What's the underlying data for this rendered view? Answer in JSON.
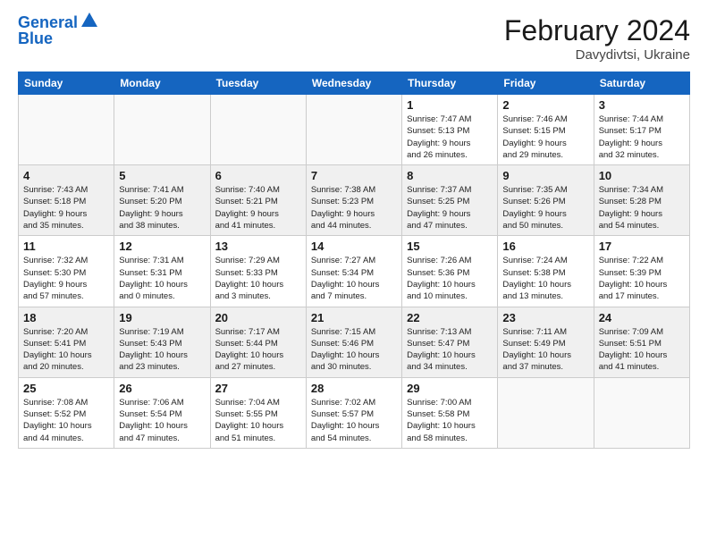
{
  "header": {
    "logo_line1": "General",
    "logo_line2": "Blue",
    "main_title": "February 2024",
    "subtitle": "Davydivtsi, Ukraine"
  },
  "days_of_week": [
    "Sunday",
    "Monday",
    "Tuesday",
    "Wednesday",
    "Thursday",
    "Friday",
    "Saturday"
  ],
  "weeks": [
    [
      {
        "day": "",
        "info": ""
      },
      {
        "day": "",
        "info": ""
      },
      {
        "day": "",
        "info": ""
      },
      {
        "day": "",
        "info": ""
      },
      {
        "day": "1",
        "info": "Sunrise: 7:47 AM\nSunset: 5:13 PM\nDaylight: 9 hours\nand 26 minutes."
      },
      {
        "day": "2",
        "info": "Sunrise: 7:46 AM\nSunset: 5:15 PM\nDaylight: 9 hours\nand 29 minutes."
      },
      {
        "day": "3",
        "info": "Sunrise: 7:44 AM\nSunset: 5:17 PM\nDaylight: 9 hours\nand 32 minutes."
      }
    ],
    [
      {
        "day": "4",
        "info": "Sunrise: 7:43 AM\nSunset: 5:18 PM\nDaylight: 9 hours\nand 35 minutes."
      },
      {
        "day": "5",
        "info": "Sunrise: 7:41 AM\nSunset: 5:20 PM\nDaylight: 9 hours\nand 38 minutes."
      },
      {
        "day": "6",
        "info": "Sunrise: 7:40 AM\nSunset: 5:21 PM\nDaylight: 9 hours\nand 41 minutes."
      },
      {
        "day": "7",
        "info": "Sunrise: 7:38 AM\nSunset: 5:23 PM\nDaylight: 9 hours\nand 44 minutes."
      },
      {
        "day": "8",
        "info": "Sunrise: 7:37 AM\nSunset: 5:25 PM\nDaylight: 9 hours\nand 47 minutes."
      },
      {
        "day": "9",
        "info": "Sunrise: 7:35 AM\nSunset: 5:26 PM\nDaylight: 9 hours\nand 50 minutes."
      },
      {
        "day": "10",
        "info": "Sunrise: 7:34 AM\nSunset: 5:28 PM\nDaylight: 9 hours\nand 54 minutes."
      }
    ],
    [
      {
        "day": "11",
        "info": "Sunrise: 7:32 AM\nSunset: 5:30 PM\nDaylight: 9 hours\nand 57 minutes."
      },
      {
        "day": "12",
        "info": "Sunrise: 7:31 AM\nSunset: 5:31 PM\nDaylight: 10 hours\nand 0 minutes."
      },
      {
        "day": "13",
        "info": "Sunrise: 7:29 AM\nSunset: 5:33 PM\nDaylight: 10 hours\nand 3 minutes."
      },
      {
        "day": "14",
        "info": "Sunrise: 7:27 AM\nSunset: 5:34 PM\nDaylight: 10 hours\nand 7 minutes."
      },
      {
        "day": "15",
        "info": "Sunrise: 7:26 AM\nSunset: 5:36 PM\nDaylight: 10 hours\nand 10 minutes."
      },
      {
        "day": "16",
        "info": "Sunrise: 7:24 AM\nSunset: 5:38 PM\nDaylight: 10 hours\nand 13 minutes."
      },
      {
        "day": "17",
        "info": "Sunrise: 7:22 AM\nSunset: 5:39 PM\nDaylight: 10 hours\nand 17 minutes."
      }
    ],
    [
      {
        "day": "18",
        "info": "Sunrise: 7:20 AM\nSunset: 5:41 PM\nDaylight: 10 hours\nand 20 minutes."
      },
      {
        "day": "19",
        "info": "Sunrise: 7:19 AM\nSunset: 5:43 PM\nDaylight: 10 hours\nand 23 minutes."
      },
      {
        "day": "20",
        "info": "Sunrise: 7:17 AM\nSunset: 5:44 PM\nDaylight: 10 hours\nand 27 minutes."
      },
      {
        "day": "21",
        "info": "Sunrise: 7:15 AM\nSunset: 5:46 PM\nDaylight: 10 hours\nand 30 minutes."
      },
      {
        "day": "22",
        "info": "Sunrise: 7:13 AM\nSunset: 5:47 PM\nDaylight: 10 hours\nand 34 minutes."
      },
      {
        "day": "23",
        "info": "Sunrise: 7:11 AM\nSunset: 5:49 PM\nDaylight: 10 hours\nand 37 minutes."
      },
      {
        "day": "24",
        "info": "Sunrise: 7:09 AM\nSunset: 5:51 PM\nDaylight: 10 hours\nand 41 minutes."
      }
    ],
    [
      {
        "day": "25",
        "info": "Sunrise: 7:08 AM\nSunset: 5:52 PM\nDaylight: 10 hours\nand 44 minutes."
      },
      {
        "day": "26",
        "info": "Sunrise: 7:06 AM\nSunset: 5:54 PM\nDaylight: 10 hours\nand 47 minutes."
      },
      {
        "day": "27",
        "info": "Sunrise: 7:04 AM\nSunset: 5:55 PM\nDaylight: 10 hours\nand 51 minutes."
      },
      {
        "day": "28",
        "info": "Sunrise: 7:02 AM\nSunset: 5:57 PM\nDaylight: 10 hours\nand 54 minutes."
      },
      {
        "day": "29",
        "info": "Sunrise: 7:00 AM\nSunset: 5:58 PM\nDaylight: 10 hours\nand 58 minutes."
      },
      {
        "day": "",
        "info": ""
      },
      {
        "day": "",
        "info": ""
      }
    ]
  ],
  "row_styles": [
    "row-white",
    "row-shaded",
    "row-white",
    "row-shaded",
    "row-white"
  ]
}
